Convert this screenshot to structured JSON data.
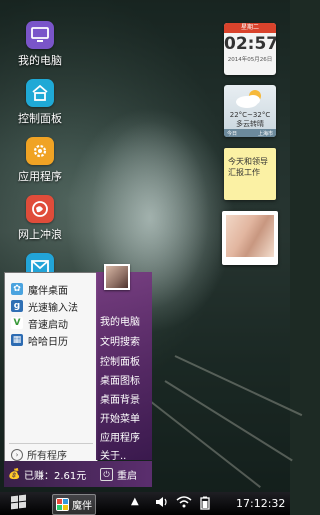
{
  "desktop_icons": [
    {
      "label": "我的电脑",
      "icon": "monitor-icon",
      "color": "#7a55c9"
    },
    {
      "label": "控制面板",
      "icon": "house-icon",
      "color": "#1fa9d6"
    },
    {
      "label": "应用程序",
      "icon": "gear-icon",
      "color": "#f0a324"
    },
    {
      "label": "网上冲浪",
      "icon": "globe-icon",
      "color": "#e04c3a"
    },
    {
      "label": "邮件",
      "icon": "mail-icon",
      "color": "#22a4d8"
    }
  ],
  "widgets": {
    "clock": {
      "header": "星期二",
      "time": "02:57",
      "date": "2014年05月26日"
    },
    "weather": {
      "temp": "22°C~32°C",
      "desc": "多云转晴",
      "day": "今日",
      "city": "上海市"
    },
    "note": {
      "text": "今天和领导汇报工作"
    }
  },
  "start_menu": {
    "apps": [
      {
        "label": "魔伴桌面",
        "icon": "puzzle-icon",
        "color": "#4aa3df"
      },
      {
        "label": "光速输入法",
        "icon": "keyboard-icon",
        "color": "#2f6fb4"
      },
      {
        "label": "音速启动",
        "icon": "check-v-icon",
        "color": "#3a9a3a"
      },
      {
        "label": "哈哈日历",
        "icon": "calendar-icon",
        "color": "#2c6bb2"
      }
    ],
    "all_programs": "所有程序",
    "right_items": [
      "我的电脑",
      "文明搜索",
      "控制面板",
      "桌面图标",
      "桌面背景",
      "开始菜单",
      "应用程序",
      "关于.."
    ],
    "earned": "已赚：2.61元",
    "restart": "重启"
  },
  "taskbar": {
    "app_label": "魔伴",
    "time": "17:12:32"
  },
  "colors": {
    "menu_purple": "#5b2e6e",
    "taskbar": "#000000"
  }
}
